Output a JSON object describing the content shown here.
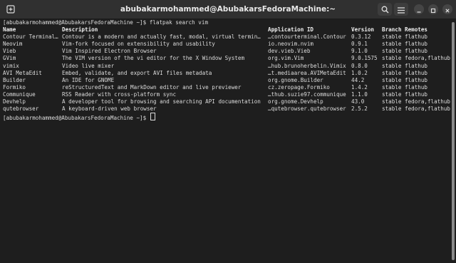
{
  "window": {
    "title": "abubakarmohammed@AbubakarsFedoraMachine:~"
  },
  "terminal": {
    "command_line": "[abubakarmohammed@AbubakarsFedoraMachine ~]$ flatpak search vim",
    "headers": {
      "name": "Name",
      "description": "Description",
      "app_id": "Application ID",
      "version": "Version",
      "branch": "Branch",
      "remotes": "Remotes"
    },
    "rows": [
      {
        "name": "Contour Terminal…",
        "description": "Contour is a modern and actually fast, modal, virtual termin…",
        "app_id": "…contourterminal.Contour",
        "version": "0.3.12",
        "branch": "stable",
        "remotes": "flathub"
      },
      {
        "name": "Neovim",
        "description": "Vim-fork focused on extensibility and usability",
        "app_id": "io.neovim.nvim",
        "version": "0.9.1",
        "branch": "stable",
        "remotes": "flathub"
      },
      {
        "name": "Vieb",
        "description": "Vim Inspired Electron Browser",
        "app_id": "dev.vieb.Vieb",
        "version": "9.1.0",
        "branch": "stable",
        "remotes": "flathub"
      },
      {
        "name": "GVim",
        "description": "The VIM version of the vi editor for the X Window System",
        "app_id": "org.vim.Vim",
        "version": "9.0.1575",
        "branch": "stable",
        "remotes": "fedora,flathub"
      },
      {
        "name": "vimix",
        "description": "Video live mixer",
        "app_id": "…hub.brunoherbelin.Vimix",
        "version": "0.8.0",
        "branch": "stable",
        "remotes": "flathub"
      },
      {
        "name": "AVI MetaEdit",
        "description": "Embed, validate, and export AVI files metadata",
        "app_id": "…t.mediaarea.AVIMetaEdit",
        "version": "1.0.2",
        "branch": "stable",
        "remotes": "flathub"
      },
      {
        "name": "Builder",
        "description": "An IDE for GNOME",
        "app_id": "org.gnome.Builder",
        "version": "44.2",
        "branch": "stable",
        "remotes": "flathub"
      },
      {
        "name": "Formiko",
        "description": "reStructuredText and MarkDown editor and live previewer",
        "app_id": "cz.zeropage.Formiko",
        "version": "1.4.2",
        "branch": "stable",
        "remotes": "flathub"
      },
      {
        "name": "Communique",
        "description": "RSS Reader with cross-platform sync",
        "app_id": "…thub.suzie97.communique",
        "version": "1.1.0",
        "branch": "stable",
        "remotes": "flathub"
      },
      {
        "name": "Devhelp",
        "description": "A developer tool for browsing and searching API documentation",
        "app_id": "org.gnome.Devhelp",
        "version": "43.0",
        "branch": "stable",
        "remotes": "fedora,flathub"
      },
      {
        "name": "qutebrowser",
        "description": "A keyboard-driven web browser",
        "app_id": "…qutebrowser.qutebrowser",
        "version": "2.5.2",
        "branch": "stable",
        "remotes": "fedora,flathub"
      }
    ],
    "prompt": "[abubakarmohammed@AbubakarsFedoraMachine ~]$ "
  },
  "icons": {
    "new_tab": "new-tab-icon",
    "search": "search-icon",
    "menu": "hamburger-menu-icon",
    "minimize": "minimize-icon",
    "maximize": "maximize-icon",
    "close": "close-icon"
  },
  "colors": {
    "titlebar": "#303030",
    "terminal_bg": "#1e1e1e",
    "text": "#dcdcdc"
  }
}
